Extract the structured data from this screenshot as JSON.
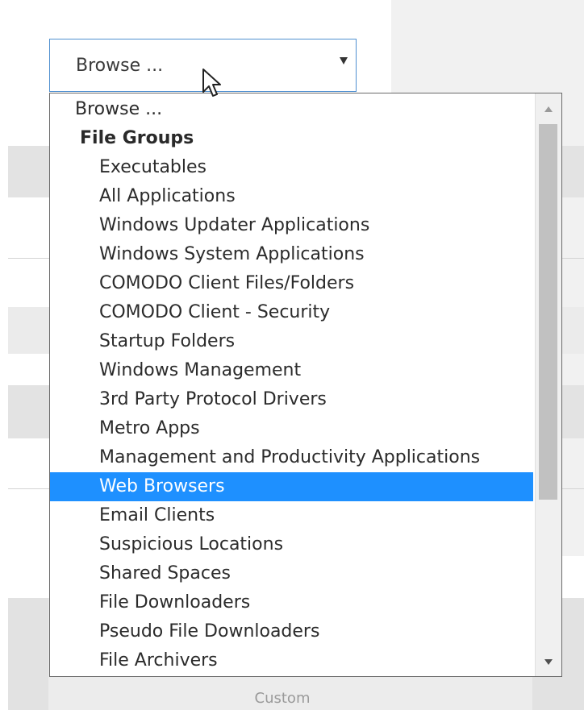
{
  "dropdown": {
    "selected_label": "Browse ...",
    "options": [
      {
        "label": "Browse ...",
        "kind": "option",
        "indent": 0,
        "selected": false
      },
      {
        "label": "File Groups",
        "kind": "group",
        "indent": 0,
        "selected": false
      },
      {
        "label": "Executables",
        "kind": "option",
        "indent": 1,
        "selected": false
      },
      {
        "label": "All Applications",
        "kind": "option",
        "indent": 1,
        "selected": false
      },
      {
        "label": "Windows Updater Applications",
        "kind": "option",
        "indent": 1,
        "selected": false
      },
      {
        "label": "Windows System Applications",
        "kind": "option",
        "indent": 1,
        "selected": false
      },
      {
        "label": "COMODO Client Files/Folders",
        "kind": "option",
        "indent": 1,
        "selected": false
      },
      {
        "label": "COMODO Client - Security",
        "kind": "option",
        "indent": 1,
        "selected": false
      },
      {
        "label": "Startup Folders",
        "kind": "option",
        "indent": 1,
        "selected": false
      },
      {
        "label": "Windows Management",
        "kind": "option",
        "indent": 1,
        "selected": false
      },
      {
        "label": "3rd Party Protocol Drivers",
        "kind": "option",
        "indent": 1,
        "selected": false
      },
      {
        "label": "Metro Apps",
        "kind": "option",
        "indent": 1,
        "selected": false
      },
      {
        "label": "Management and Productivity Applications",
        "kind": "option",
        "indent": 1,
        "selected": false
      },
      {
        "label": "Web Browsers",
        "kind": "option",
        "indent": 1,
        "selected": true
      },
      {
        "label": "Email Clients",
        "kind": "option",
        "indent": 1,
        "selected": false
      },
      {
        "label": "Suspicious Locations",
        "kind": "option",
        "indent": 1,
        "selected": false
      },
      {
        "label": "Shared Spaces",
        "kind": "option",
        "indent": 1,
        "selected": false
      },
      {
        "label": "File Downloaders",
        "kind": "option",
        "indent": 1,
        "selected": false
      },
      {
        "label": "Pseudo File Downloaders",
        "kind": "option",
        "indent": 1,
        "selected": false
      },
      {
        "label": "File Archivers",
        "kind": "option",
        "indent": 1,
        "selected": false
      }
    ]
  },
  "background": {
    "custom_label": "Custom"
  },
  "colors": {
    "selection": "#1e90ff",
    "select_border": "#4f90d0"
  },
  "icons": {
    "dropdown_arrow": "chevron-down-icon",
    "cursor": "mouse-pointer-icon"
  }
}
